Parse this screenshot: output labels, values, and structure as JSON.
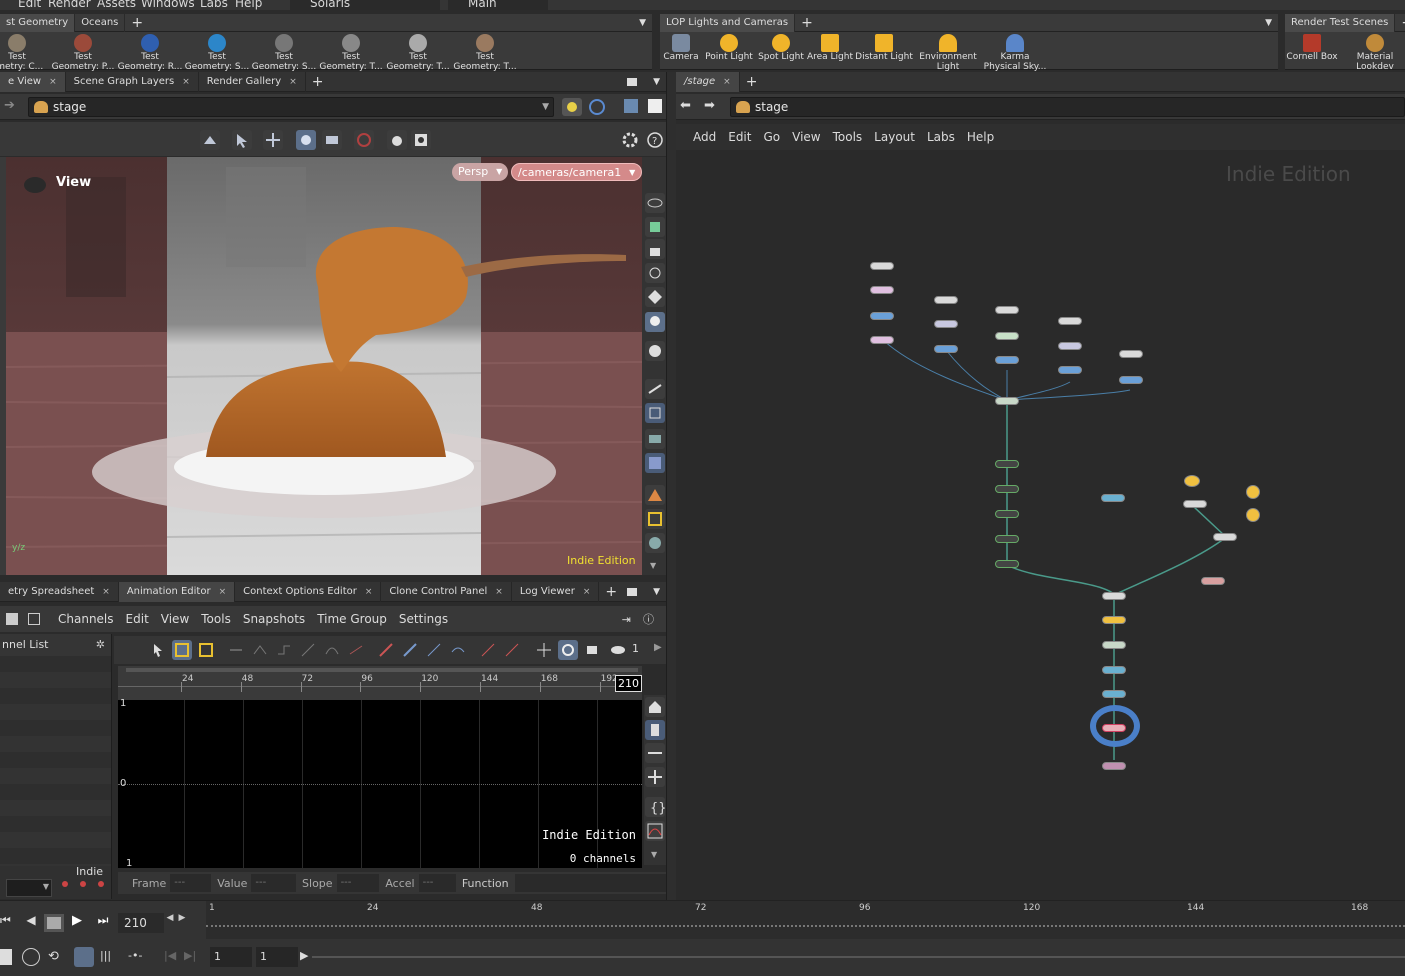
{
  "menubar": [
    "Edit",
    "Render",
    "Assets",
    "Windows",
    "Labs",
    "Help"
  ],
  "desktop": "Solaris",
  "context": "Main",
  "shelf_left": {
    "tabs": [
      "st Geometry",
      "Oceans"
    ],
    "tools": [
      {
        "label1": "Test",
        "label2": "ometry: C..."
      },
      {
        "label1": "Test",
        "label2": "Geometry: P..."
      },
      {
        "label1": "Test",
        "label2": "Geometry: R..."
      },
      {
        "label1": "Test",
        "label2": "Geometry: S..."
      },
      {
        "label1": "Test",
        "label2": "Geometry: S..."
      },
      {
        "label1": "Test",
        "label2": "Geometry: T..."
      },
      {
        "label1": "Test",
        "label2": "Geometry: T..."
      },
      {
        "label1": "Test",
        "label2": "Geometry: T..."
      }
    ]
  },
  "shelf_mid": {
    "tabs": [
      "LOP Lights and Cameras"
    ],
    "tools": [
      {
        "label1": "Camera",
        "label2": ""
      },
      {
        "label1": "Point Light",
        "label2": ""
      },
      {
        "label1": "Spot Light",
        "label2": ""
      },
      {
        "label1": "Area Light",
        "label2": ""
      },
      {
        "label1": "Distant Light",
        "label2": ""
      },
      {
        "label1": "Environment",
        "label2": "Light"
      },
      {
        "label1": "Karma",
        "label2": "Physical Sky..."
      }
    ]
  },
  "shelf_right": {
    "tabs": [
      "Render Test Scenes"
    ],
    "tools": [
      {
        "label1": "Cornell Box",
        "label2": ""
      },
      {
        "label1": "Material",
        "label2": "Lookdev"
      }
    ]
  },
  "left_tabs": [
    "e View",
    "Scene Graph Layers",
    "Render Gallery"
  ],
  "left_path": "stage",
  "viewport": {
    "title": "View",
    "persp": "Persp",
    "camera": "/cameras/camera1",
    "watermark": "Indie Edition"
  },
  "bottom_tabs": [
    "etry Spreadsheet",
    "Animation Editor",
    "Context Options Editor",
    "Clone Control Panel",
    "Log Viewer"
  ],
  "anim_menu": [
    "Channels",
    "Edit",
    "View",
    "Tools",
    "Snapshots",
    "Time Group",
    "Settings"
  ],
  "channel_list": {
    "title": "nnel List",
    "footer": "Indie"
  },
  "anim_graph": {
    "ruler_ticks": [
      "24",
      "48",
      "72",
      "96",
      "120",
      "144",
      "168",
      "192"
    ],
    "end_frame": "210",
    "y_labels": [
      "1",
      "0",
      "1"
    ],
    "watermark": "Indie Edition",
    "channels": "0 channels",
    "page_num": "1"
  },
  "anim_fields": [
    {
      "label": "Frame",
      "value": "---"
    },
    {
      "label": "Value",
      "value": "---"
    },
    {
      "label": "Slope",
      "value": "---"
    },
    {
      "label": "Accel",
      "value": "---"
    },
    {
      "label": "Function",
      "value": ""
    }
  ],
  "right_tabs": [
    "/stage"
  ],
  "right_path": "stage",
  "net_menu": [
    "Add",
    "Edit",
    "Go",
    "View",
    "Tools",
    "Layout",
    "Labs",
    "Help"
  ],
  "network": {
    "watermark": "Indie Edition"
  },
  "timeline": {
    "current_frame": "210",
    "ticks": [
      "1",
      "24",
      "48",
      "72",
      "96",
      "120",
      "144",
      "168"
    ],
    "start": "1",
    "start2": "1"
  }
}
